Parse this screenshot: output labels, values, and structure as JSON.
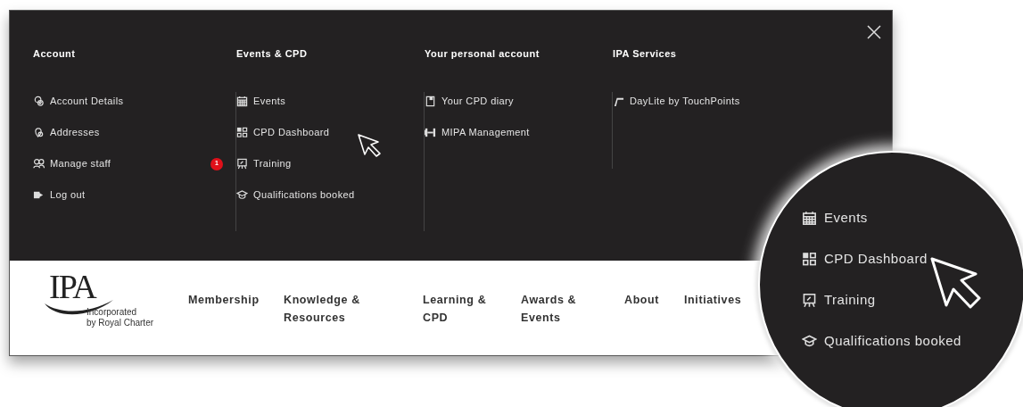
{
  "menu_columns": [
    {
      "heading": "Account",
      "items": [
        {
          "label": "Account Details"
        },
        {
          "label": "Addresses"
        },
        {
          "label": "Manage staff",
          "badge": "1"
        },
        {
          "label": "Log out"
        }
      ]
    },
    {
      "heading": "Events & CPD",
      "items": [
        {
          "label": "Events"
        },
        {
          "label": "CPD Dashboard"
        },
        {
          "label": "Training"
        },
        {
          "label": "Qualifications booked"
        }
      ]
    },
    {
      "heading": "Your personal account",
      "items": [
        {
          "label": "Your CPD diary"
        },
        {
          "label": "MIPA Management"
        }
      ]
    },
    {
      "heading": "IPA Services",
      "items": [
        {
          "label": "DayLite by TouchPoints"
        }
      ]
    }
  ],
  "logo": {
    "name": "IPA",
    "tagline_1": "Incorporated",
    "tagline_2": "by Royal Charter"
  },
  "nav": [
    {
      "label": "Membership"
    },
    {
      "label": "Knowledge & Resources"
    },
    {
      "label": "Learning & CPD"
    },
    {
      "label": "Awards & Events"
    },
    {
      "label": "About"
    },
    {
      "label": "Initiatives"
    }
  ],
  "magnifier": {
    "items": [
      {
        "label": "Events"
      },
      {
        "label": "CPD Dashboard"
      },
      {
        "label": "Training"
      },
      {
        "label": "Qualifications booked"
      }
    ]
  }
}
